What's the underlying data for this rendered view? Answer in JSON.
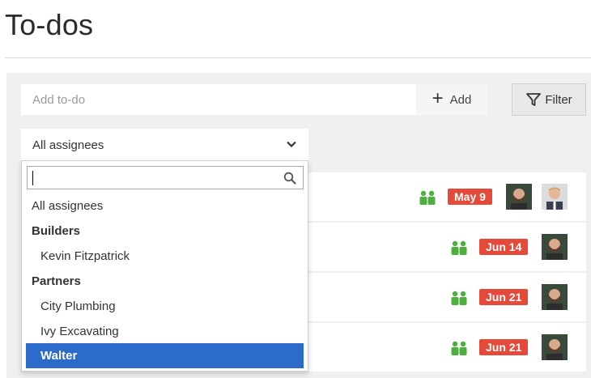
{
  "page": {
    "title": "To-dos"
  },
  "toolbar": {
    "add_placeholder": "Add to-do",
    "add_label": "Add",
    "filter_label": "Filter"
  },
  "assignee_select": {
    "selected": "All assignees",
    "search_value": "",
    "options": {
      "all": "All assignees",
      "group_builders": "Builders",
      "kevin": "Kevin Fitzpatrick",
      "group_partners": "Partners",
      "city_plumbing": "City Plumbing",
      "ivy_excavating": "Ivy Excavating",
      "walter": "Walter"
    },
    "highlighted": "Walter"
  },
  "todos": [
    {
      "date": "May 9",
      "avatars": [
        "avatar-man-beard",
        "avatar-man-suit"
      ]
    },
    {
      "date": "Jun 14",
      "avatars": [
        "avatar-man-beard"
      ]
    },
    {
      "date": "Jun 21",
      "avatars": [
        "avatar-man-beard"
      ]
    },
    {
      "date": "Jun 21",
      "avatars": [
        "avatar-man-beard"
      ]
    }
  ],
  "colors": {
    "accent_green": "#4caf3e",
    "badge_red": "#e4493a",
    "selection_blue": "#2c6bc9"
  }
}
